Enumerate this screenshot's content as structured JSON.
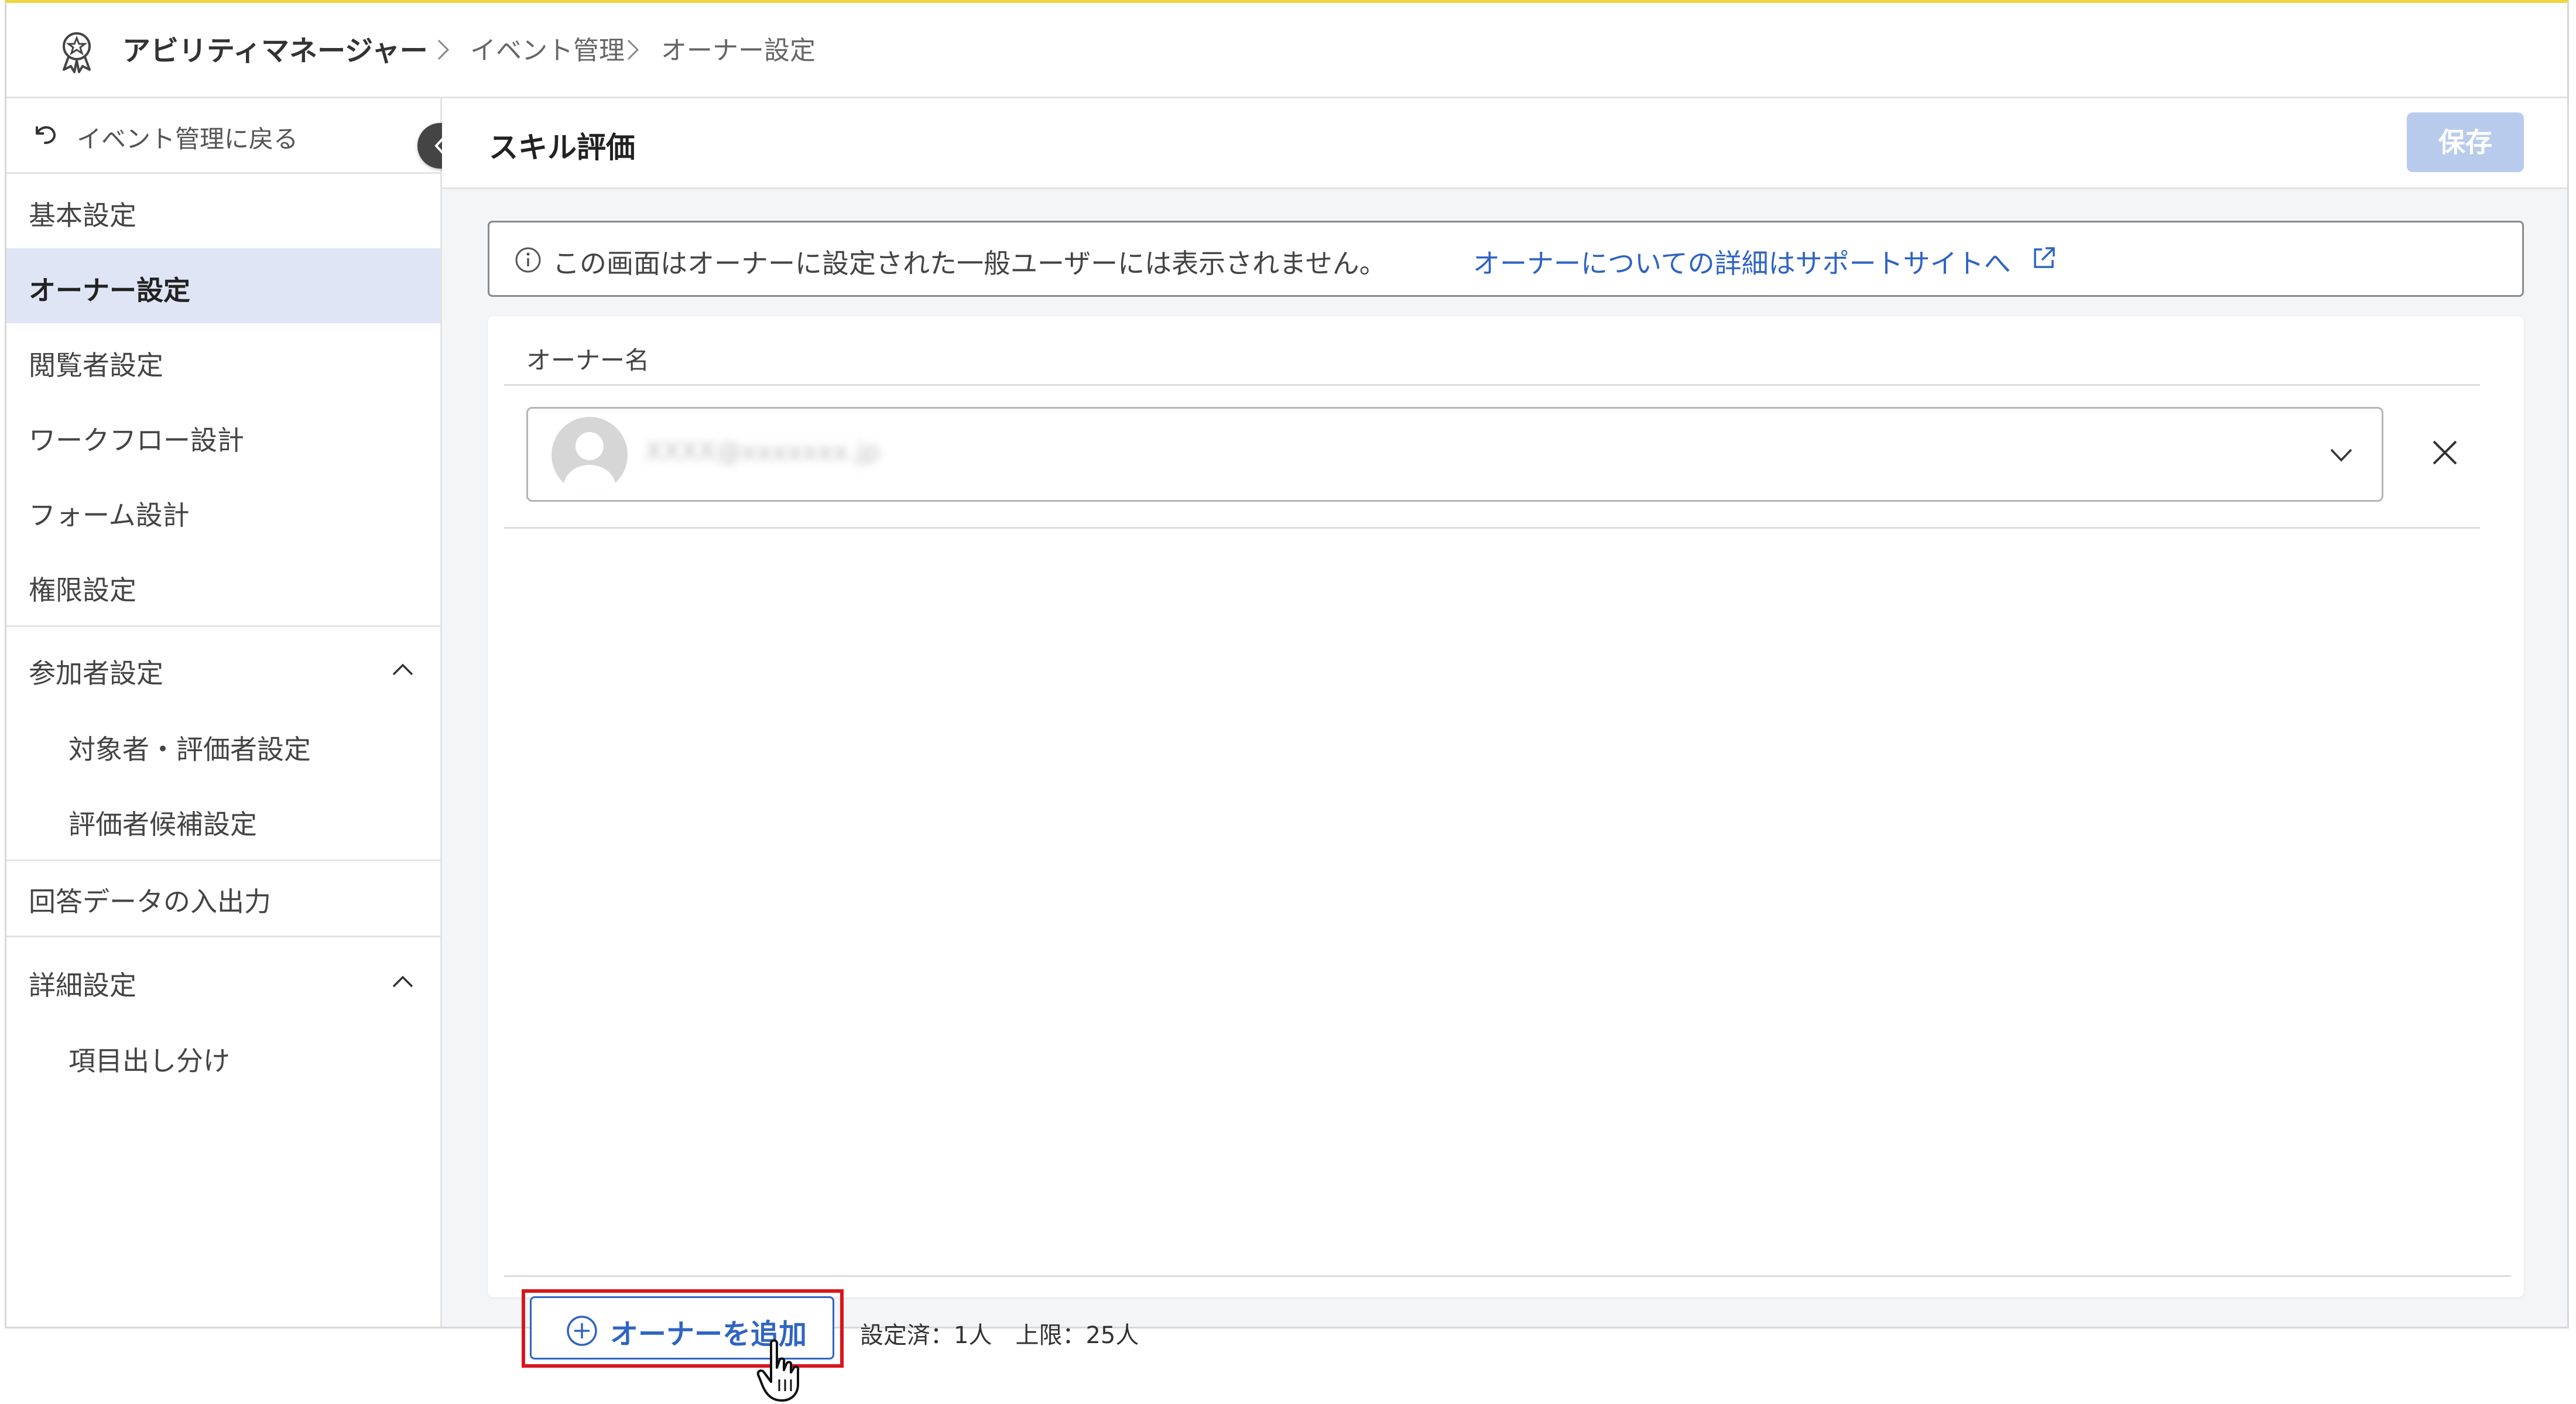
{
  "header": {
    "app_name": "アビリティマネージャー",
    "breadcrumb": [
      "イベント管理",
      "オーナー設定"
    ],
    "logo_icon": "award-badge-icon"
  },
  "sidebar": {
    "back_label": "イベント管理に戻る",
    "items": [
      {
        "label": "基本設定"
      },
      {
        "label": "オーナー設定",
        "active": true
      },
      {
        "label": "閲覧者設定"
      },
      {
        "label": "ワークフロー設計"
      },
      {
        "label": "フォーム設計"
      },
      {
        "label": "権限設定"
      }
    ],
    "groups": [
      {
        "label": "参加者設定",
        "expanded": true,
        "children": [
          "対象者・評価者設定",
          "評価者候補設定"
        ]
      },
      {
        "label": "回答データの入出力"
      },
      {
        "label": "詳細設定",
        "expanded": true,
        "children": [
          "項目出し分け"
        ]
      }
    ]
  },
  "main": {
    "title": "スキル評価",
    "save_label": "保存",
    "notice_text": "この画面はオーナーに設定された一般ユーザーには表示されません。",
    "notice_link": "オーナーについての詳細はサポートサイトへ",
    "column_header": "オーナー名",
    "owner_email": "XXXX@xxxxxxx.jp",
    "add_owner_label": "オーナーを追加",
    "count_info": "設定済：1人　上限：25人"
  },
  "colors": {
    "accent": "#2f64c2",
    "active_bg": "#dfe5f5",
    "save_disabled": "#b9cbec",
    "highlight": "#d8161c",
    "top_border": "#f0d540"
  }
}
